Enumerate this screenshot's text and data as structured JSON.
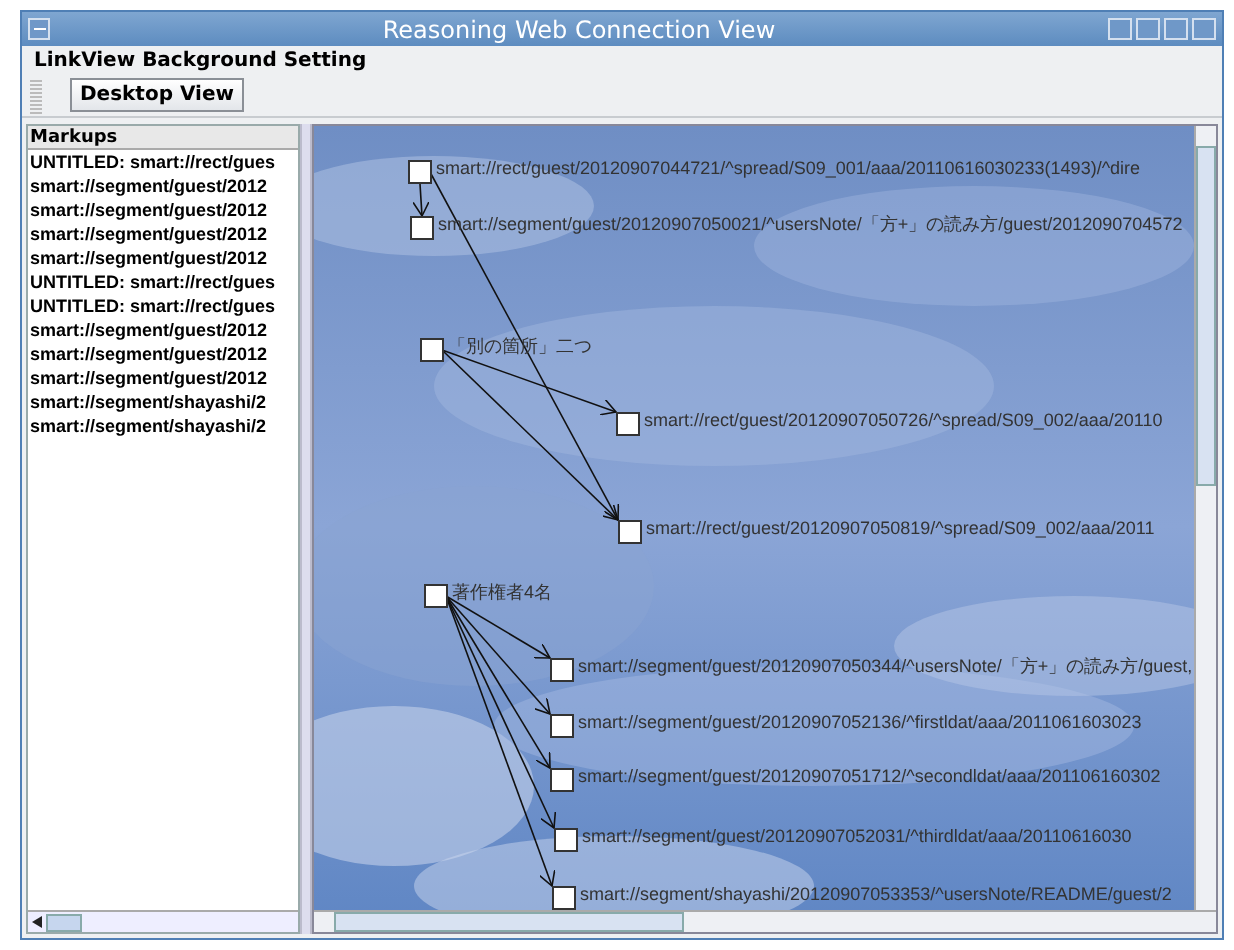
{
  "window": {
    "title": "Reasoning Web Connection View"
  },
  "menu": [
    "LinkView Background Setting"
  ],
  "toolbar": {
    "buttons": [
      "Desktop View"
    ]
  },
  "markups": {
    "header": "Markups",
    "items": [
      "UNTITLED: smart://rect/gues",
      "smart://segment/guest/2012",
      "smart://segment/guest/2012",
      "smart://segment/guest/2012",
      "smart://segment/guest/2012",
      "UNTITLED: smart://rect/gues",
      "UNTITLED: smart://rect/gues",
      "smart://segment/guest/2012",
      "smart://segment/guest/2012",
      "smart://segment/guest/2012",
      "smart://segment/shayashi/2",
      "smart://segment/shayashi/2"
    ]
  },
  "graph": {
    "nodes": [
      {
        "label": "smart://rect/guest/20120907044721/^spread/S09_001/aaa/20110616030233(1493)/^dire"
      },
      {
        "label": "smart://segment/guest/20120907050021/^usersNote/「方+」の読み方/guest/2012090704572"
      },
      {
        "label": "「別の箇所」二つ"
      },
      {
        "label": "smart://rect/guest/20120907050726/^spread/S09_002/aaa/20110"
      },
      {
        "label": "smart://rect/guest/20120907050819/^spread/S09_002/aaa/2011"
      },
      {
        "label": "著作権者4名"
      },
      {
        "label": "smart://segment/guest/20120907050344/^usersNote/「方+」の読み方/guest,"
      },
      {
        "label": "smart://segment/guest/20120907052136/^firstldat/aaa/2011061603023"
      },
      {
        "label": "smart://segment/guest/20120907051712/^secondldat/aaa/201106160302"
      },
      {
        "label": "smart://segment/guest/20120907052031/^thirdldat/aaa/20110616030"
      },
      {
        "label": "smart://segment/shayashi/20120907053353/^usersNote/README/guest/2"
      }
    ]
  }
}
